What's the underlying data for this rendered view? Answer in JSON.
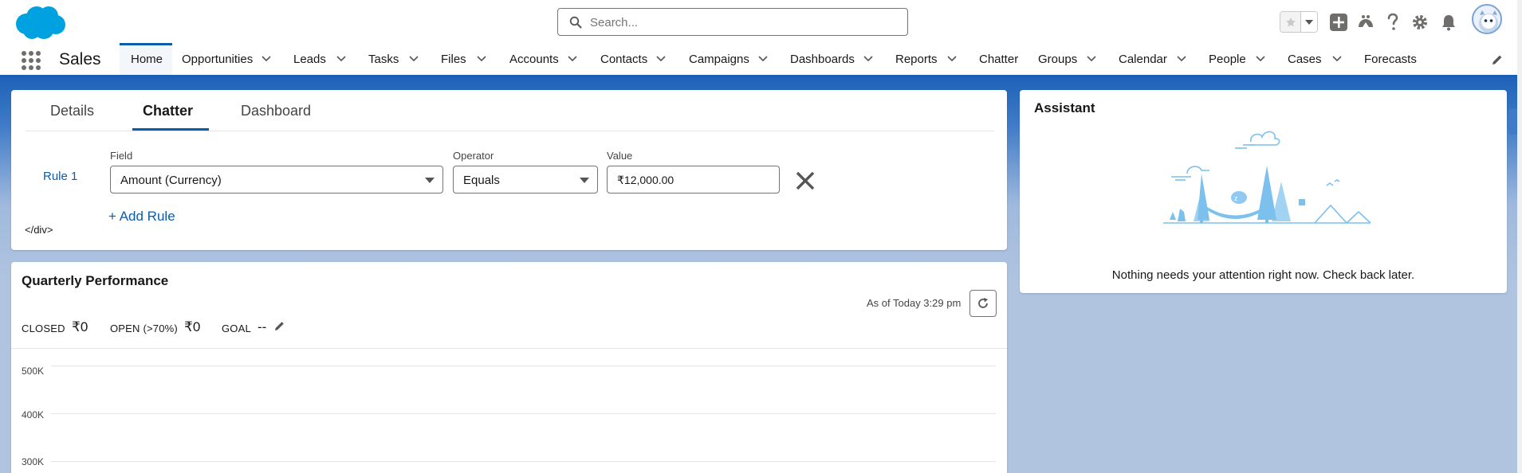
{
  "header": {
    "search": {
      "placeholder": "Search..."
    },
    "icons": [
      "salesforce-logo",
      "search-icon",
      "star-icon",
      "chevron-down-icon",
      "plus-icon",
      "trailhead-icon",
      "help-icon",
      "gear-icon",
      "bell-icon",
      "avatar"
    ]
  },
  "nav": {
    "app_name": "Sales",
    "items": [
      {
        "label": "Home"
      },
      {
        "label": "Opportunities"
      },
      {
        "label": "Leads"
      },
      {
        "label": "Tasks"
      },
      {
        "label": "Files"
      },
      {
        "label": "Accounts"
      },
      {
        "label": "Contacts"
      },
      {
        "label": "Campaigns"
      },
      {
        "label": "Dashboards"
      },
      {
        "label": "Reports"
      },
      {
        "label": "Chatter"
      },
      {
        "label": "Groups"
      },
      {
        "label": "Calendar"
      },
      {
        "label": "People"
      },
      {
        "label": "Cases"
      },
      {
        "label": "Forecasts"
      }
    ]
  },
  "record_tabs": {
    "tabs": [
      {
        "label": "Details"
      },
      {
        "label": "Chatter"
      },
      {
        "label": "Dashboard"
      }
    ],
    "active": "Chatter"
  },
  "rule": {
    "label": "Rule 1",
    "field_label": "Field",
    "field_value": "Amount (Currency)",
    "operator_label": "Operator",
    "operator_value": "Equals",
    "value_label": "Value",
    "value": "₹12,000.00",
    "add_rule": "+ Add Rule",
    "stray_text": "</div>"
  },
  "performance": {
    "title": "Quarterly Performance",
    "as_of": "As of Today 3:29 pm",
    "closed_label": "CLOSED",
    "closed_value": "₹0",
    "open_label": "OPEN (>70%)",
    "open_value": "₹0",
    "goal_label": "GOAL",
    "goal_value": "--",
    "y_ticks": [
      "500K",
      "400K",
      "300K"
    ]
  },
  "assistant": {
    "title": "Assistant",
    "message": "Nothing needs your attention right now. Check back later."
  },
  "colors": {
    "brand_blue": "#0b5cab",
    "band_blue": "#1e62b8",
    "logo_blue": "#00a1e0",
    "page_bg": "#b0c4df"
  }
}
